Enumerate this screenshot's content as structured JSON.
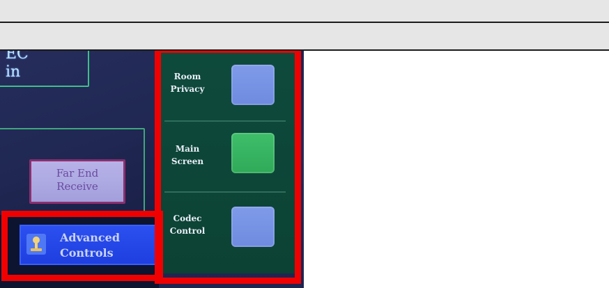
{
  "panel": {
    "partial_text": "EC\nin",
    "far_end_label": "Far End\nReceive",
    "advanced_label": "Advanced\nControls",
    "slots": [
      {
        "label": "Room\nPrivacy",
        "color": "#7e9ae8"
      },
      {
        "label": "Main\nScreen",
        "color": "#3fbe6a"
      },
      {
        "label": "Codec\nControl",
        "color": "#7e9ae8"
      }
    ]
  },
  "colors": {
    "highlight": "#f00000",
    "panel_green": "#0e4a3c",
    "advanced_blue": "#2b4ff0"
  },
  "icons": [
    "advanced-controls-icon"
  ]
}
